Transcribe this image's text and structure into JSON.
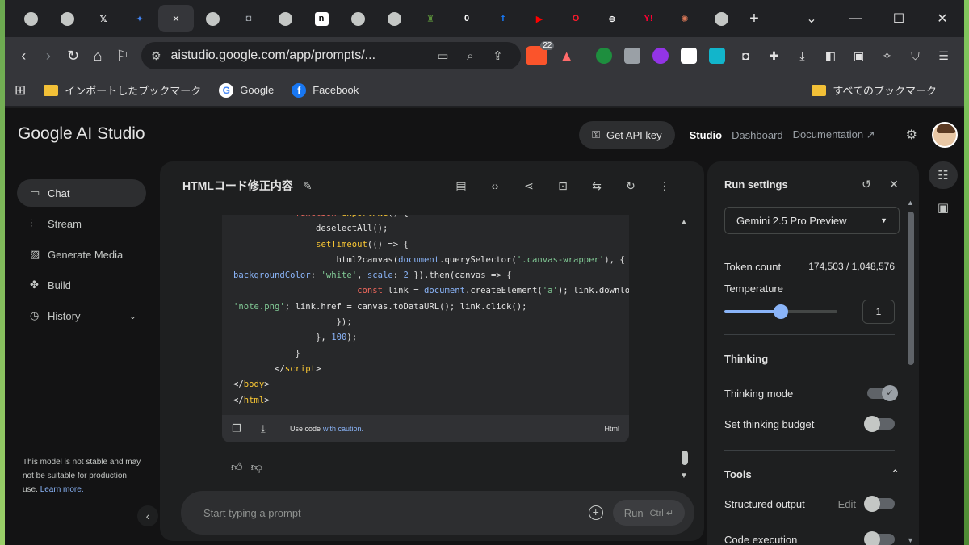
{
  "browser": {
    "tabs": [
      {
        "icon": "globe-icon",
        "glyph": ""
      },
      {
        "icon": "globe-icon",
        "glyph": ""
      },
      {
        "icon": "x-logo-icon",
        "glyph": "𝕏",
        "color": "#000000"
      },
      {
        "icon": "gemini-star-icon",
        "glyph": "✦",
        "color": "#4285f4"
      },
      {
        "icon": "close-icon",
        "glyph": "✕",
        "active": true
      },
      {
        "icon": "globe-icon",
        "glyph": ""
      },
      {
        "icon": "camera-icon",
        "glyph": "◘",
        "color": "#9aa0a6"
      },
      {
        "icon": "globe-icon",
        "glyph": ""
      },
      {
        "icon": "note-logo-icon",
        "glyph": "n",
        "color": "#ffffff"
      },
      {
        "icon": "globe-icon",
        "glyph": ""
      },
      {
        "icon": "globe-icon",
        "glyph": ""
      },
      {
        "icon": "bottle-icon",
        "glyph": "♜",
        "color": "#5a8f3a"
      },
      {
        "icon": "zero-logo-icon",
        "glyph": "0",
        "color": "#ffffff"
      },
      {
        "icon": "facebook-icon",
        "glyph": "f",
        "color": "#1877f2"
      },
      {
        "icon": "youtube-icon",
        "glyph": "▶",
        "color": "#ff0000"
      },
      {
        "icon": "opera-icon",
        "glyph": "O",
        "color": "#ff1b2d"
      },
      {
        "icon": "chatgpt-icon",
        "glyph": "⊛",
        "color": "#ffffff"
      },
      {
        "icon": "yahoo-icon",
        "glyph": "Y!",
        "color": "#ff0033"
      },
      {
        "icon": "claude-icon",
        "glyph": "✺",
        "color": "#d97757"
      },
      {
        "icon": "globe-icon",
        "glyph": ""
      }
    ],
    "url": "aistudio.google.com/app/prompts/...",
    "brave_badge": "22",
    "bookmarks": {
      "imported": "インポートしたブックマーク",
      "google": "Google",
      "facebook": "Facebook",
      "all": "すべてのブックマーク"
    }
  },
  "app": {
    "logo": "Google AI Studio",
    "get_api_key": "Get API key",
    "nav": {
      "studio": "Studio",
      "dashboard": "Dashboard",
      "documentation": "Documentation"
    },
    "sidebar": {
      "items": [
        {
          "label": "Chat",
          "icon": "chat-icon"
        },
        {
          "label": "Stream",
          "icon": "stream-icon"
        },
        {
          "label": "Generate Media",
          "icon": "media-icon"
        },
        {
          "label": "Build",
          "icon": "build-icon"
        },
        {
          "label": "History",
          "icon": "history-icon"
        }
      ],
      "note": "This model is not stable and may not be suitable for production use.",
      "learn_more": "Learn more."
    },
    "chat": {
      "title": "HTMLコード修正内容",
      "code_footer": {
        "use_code": "Use code",
        "with_caution": "with caution.",
        "lang": "Html"
      },
      "prompt_placeholder": "Start typing a prompt",
      "run": "Run",
      "run_shortcut": "Ctrl ↵"
    },
    "settings": {
      "title": "Run settings",
      "model": "Gemini 2.5 Pro Preview",
      "token_label": "Token count",
      "token_value": "174,503 / 1,048,576",
      "temperature_label": "Temperature",
      "temperature_value": "1",
      "temperature_fraction": 0.5,
      "thinking": "Thinking",
      "thinking_mode": "Thinking mode",
      "thinking_mode_on": true,
      "thinking_budget": "Set thinking budget",
      "tools": "Tools",
      "structured_output": "Structured output",
      "edit": "Edit",
      "code_execution": "Code execution"
    }
  }
}
